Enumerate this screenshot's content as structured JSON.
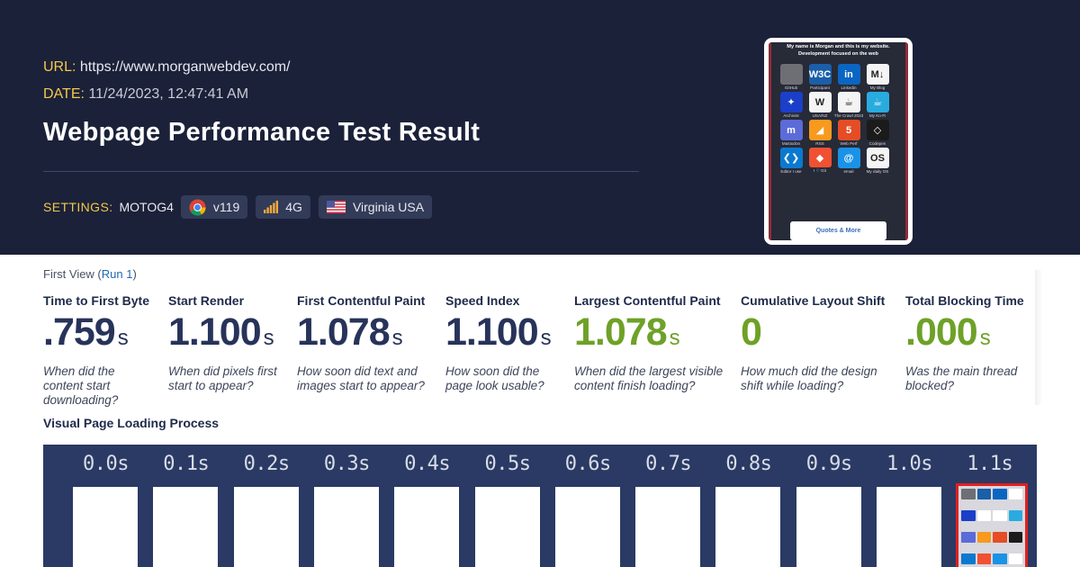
{
  "header": {
    "url_label": "URL:",
    "url": "https://www.morganwebdev.com/",
    "date_label": "DATE:",
    "date": "11/24/2023, 12:47:41 AM",
    "title": "Webpage Performance Test Result",
    "settings_label": "SETTINGS:",
    "device": "MOTOG4",
    "browser_version": "v119",
    "connection": "4G",
    "location": "Virginia USA"
  },
  "preview": {
    "heading_line1": "My name is Morgan and this is my website.",
    "heading_line2": "Development focused on the web",
    "icons": [
      {
        "label": "GitHub",
        "glyph": "",
        "color": "#6e6e75",
        "icon": "github-icon"
      },
      {
        "label": "Participant",
        "glyph": "W3C",
        "color": "#1a5fa8",
        "icon": "w3c-icon"
      },
      {
        "label": "Linkedin",
        "glyph": "in",
        "color": "#0a66c2",
        "icon": "linkedin-icon"
      },
      {
        "label": "My Blog",
        "glyph": "M↓",
        "color": "#f4f4f4",
        "icon": "markdown-icon"
      },
      {
        "label": "Archivist",
        "glyph": "✦",
        "color": "#1b3fc9",
        "icon": "archivist-icon"
      },
      {
        "label": "USA/NZ",
        "glyph": "W",
        "color": "#f4f4f4",
        "icon": "wikipedia-icon"
      },
      {
        "label": "The Crawl 2023",
        "glyph": "☕",
        "color": "#f4f4f4",
        "icon": "crawl-icon"
      },
      {
        "label": "My Ko-Fi",
        "glyph": "☕",
        "color": "#29abe0",
        "icon": "kofi-icon"
      },
      {
        "label": "Mastodon",
        "glyph": "m",
        "color": "#5b6bd8",
        "icon": "mastodon-icon"
      },
      {
        "label": "RSS",
        "glyph": "◢",
        "color": "#f79a1e",
        "icon": "rss-icon"
      },
      {
        "label": "Web Perf",
        "glyph": "5",
        "color": "#e44d26",
        "icon": "html5-icon"
      },
      {
        "label": "Codepen",
        "glyph": "◇",
        "color": "#1b1b1b",
        "icon": "codepen-icon"
      },
      {
        "label": "Editor I use",
        "glyph": "❮❯",
        "color": "#0b79d0",
        "icon": "vscode-icon"
      },
      {
        "label": "I ♡ Git",
        "glyph": "◆",
        "color": "#f05133",
        "icon": "git-icon"
      },
      {
        "label": "email",
        "glyph": "@",
        "color": "#1a93e6",
        "icon": "email-icon"
      },
      {
        "label": "My daily OS",
        "glyph": "OS",
        "color": "#f4f4f4",
        "icon": "macos-icon"
      }
    ],
    "button": "Quotes & More"
  },
  "view": {
    "prefix": "First View (",
    "run_link": "Run 1",
    "suffix": ")"
  },
  "metrics": [
    {
      "label": "Time to First Byte",
      "value": ".759",
      "unit": "s",
      "desc": "When did the content start downloading?",
      "good": false
    },
    {
      "label": "Start Render",
      "value": "1.100",
      "unit": "s",
      "desc": "When did pixels first start to appear?",
      "good": false
    },
    {
      "label": "First Contentful Paint",
      "value": "1.078",
      "unit": "s",
      "desc": "How soon did text and images start to appear?",
      "good": false
    },
    {
      "label": "Speed Index",
      "value": "1.100",
      "unit": "s",
      "desc": "How soon did the page look usable?",
      "good": false
    },
    {
      "label": "Largest Contentful Paint",
      "value": "1.078",
      "unit": "s",
      "desc": "When did the largest visible content finish loading?",
      "good": true
    },
    {
      "label": "Cumulative Layout Shift",
      "value": "0",
      "unit": "",
      "desc": "How much did the design shift while loading?",
      "good": true
    },
    {
      "label": "Total Blocking Time",
      "value": ".000",
      "unit": "s",
      "desc": "Was the main thread blocked?",
      "good": true
    }
  ],
  "filmstrip": {
    "title": "Visual Page Loading Process",
    "frames": [
      "0.0s",
      "0.1s",
      "0.2s",
      "0.3s",
      "0.4s",
      "0.5s",
      "0.6s",
      "0.7s",
      "0.8s",
      "0.9s",
      "1.0s",
      "1.1s"
    ]
  },
  "colors": {
    "header_bg": "#1b2139",
    "label_yellow": "#f2c94c",
    "good_green": "#6ea128",
    "value_navy": "#27335a",
    "filmstrip_bg": "#2a3a64",
    "highlight_red": "#e02020"
  }
}
